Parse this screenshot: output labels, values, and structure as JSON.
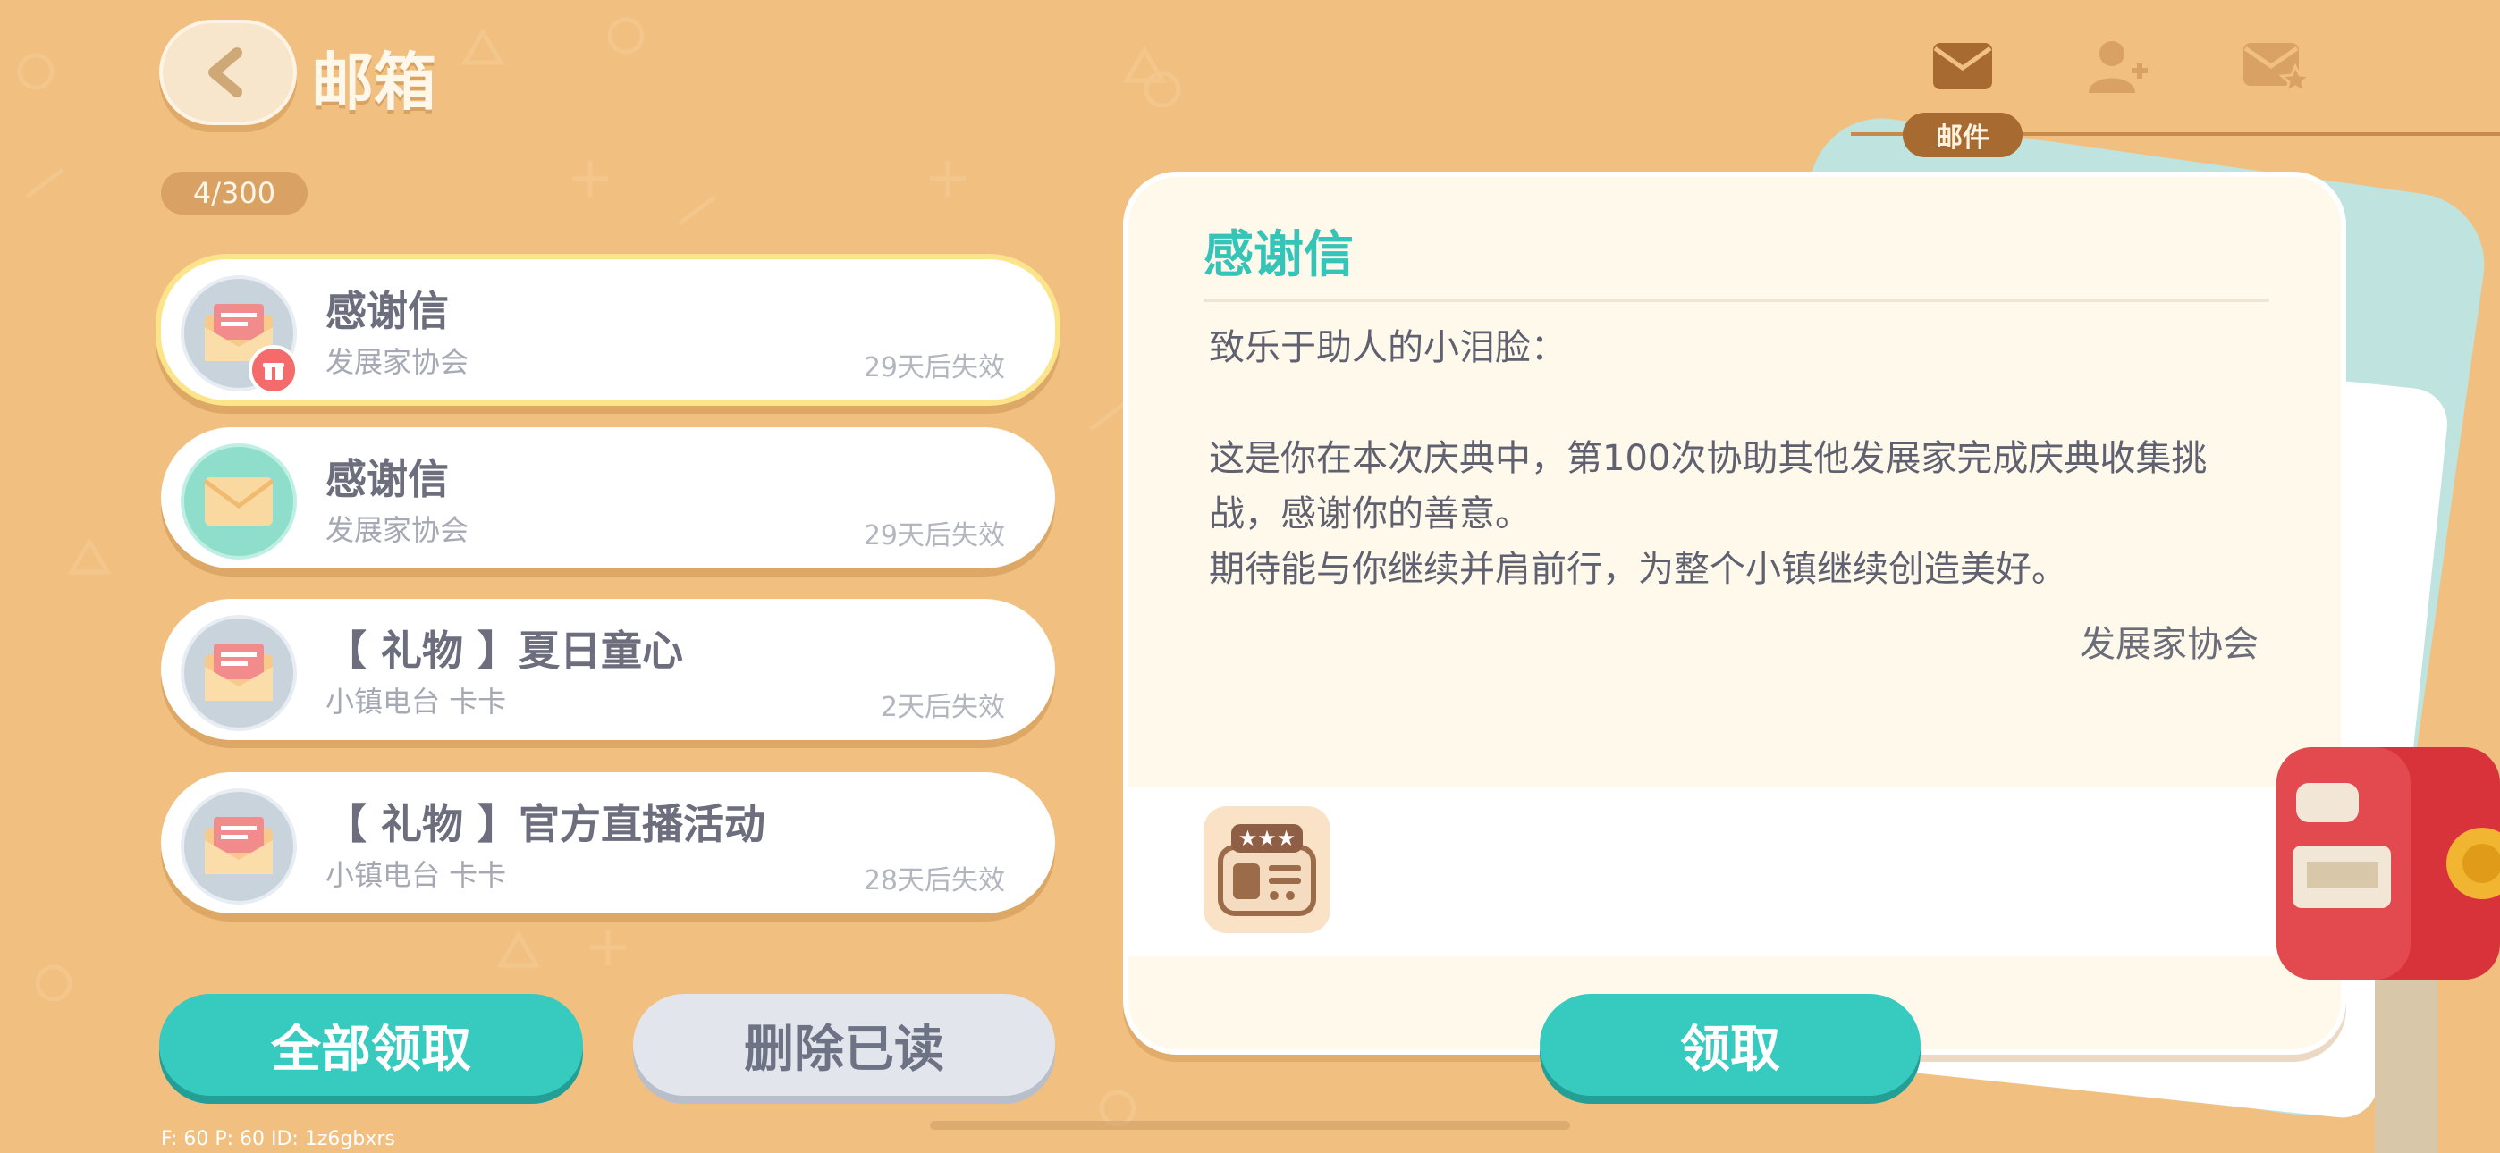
{
  "header": {
    "title": "邮箱",
    "counter": "4/300"
  },
  "tabs": [
    {
      "icon": "envelope-icon",
      "label": "邮件",
      "active": true
    },
    {
      "icon": "add-friend-icon",
      "active": false
    },
    {
      "icon": "starred-mail-icon",
      "active": false
    }
  ],
  "mail_list": [
    {
      "title": "感谢信",
      "sender": "发展家协会",
      "expiry": "29天后失效",
      "icon": "gift-envelope-icon",
      "selected": true
    },
    {
      "title": "感谢信",
      "sender": "发展家协会",
      "expiry": "29天后失效",
      "icon": "open-envelope-icon",
      "selected": false
    },
    {
      "title": "【 礼物 】夏日童心",
      "sender": "小镇电台 卡卡",
      "expiry": "2天后失效",
      "icon": "gift-envelope-icon",
      "selected": false
    },
    {
      "title": "【 礼物 】官方直播活动",
      "sender": "小镇电台 卡卡",
      "expiry": "28天后失效",
      "icon": "gift-envelope-icon",
      "selected": false
    }
  ],
  "buttons": {
    "claim_all": "全部领取",
    "delete_read": "删除已读",
    "claim": "领取"
  },
  "detail": {
    "title": "感谢信",
    "greeting": "致乐于助人的小泪脸：",
    "body_1": "这是你在本次庆典中，第100次协助其他发展家完成庆典收集挑战，感谢你的善意。",
    "body_2": "期待能与你继续并肩前行，为整个小镇继续创造美好。",
    "signature": "发展家协会",
    "attachment_icon": "badge-card-icon"
  },
  "debug": "F: 60    P: 60    ID: 1z6gbxrs"
}
